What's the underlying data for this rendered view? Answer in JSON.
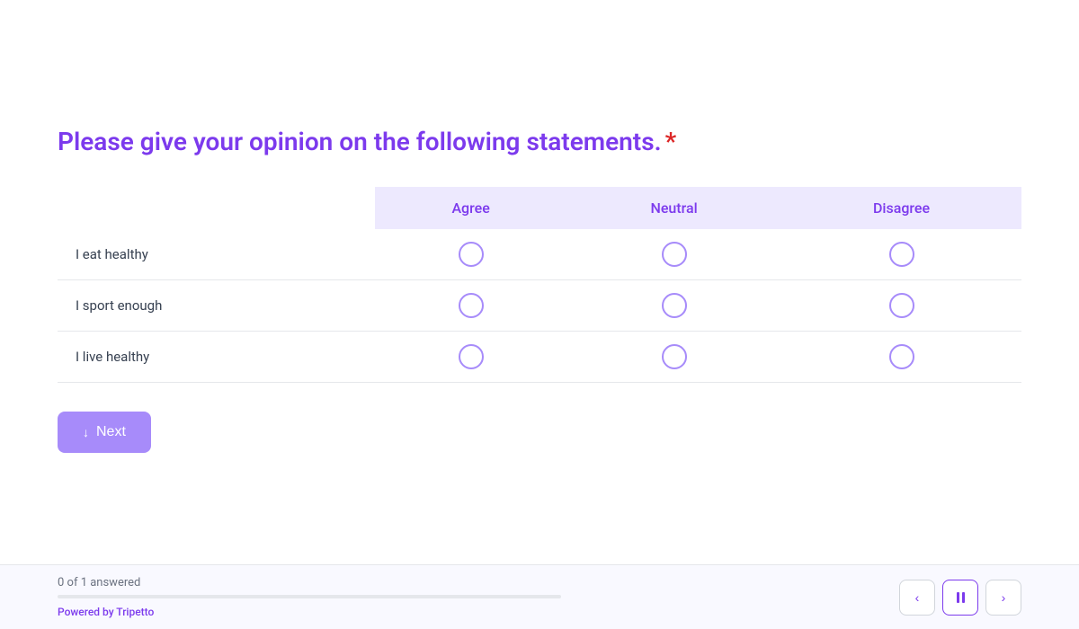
{
  "question": {
    "title": "Please give your opinion on the following statements.",
    "required": true,
    "required_symbol": "*"
  },
  "matrix": {
    "columns": [
      "Agree",
      "Neutral",
      "Disagree"
    ],
    "rows": [
      {
        "label": "I eat healthy"
      },
      {
        "label": "I sport enough"
      },
      {
        "label": "I live healthy"
      }
    ]
  },
  "next_button": {
    "label": "Next"
  },
  "footer": {
    "answered_text": "0 of 1 answered",
    "progress_percent": 0,
    "powered_by_prefix": "Powered by ",
    "powered_by_brand": "Tripetto"
  },
  "nav": {
    "prev_label": "←",
    "pause_label": "⏸",
    "next_label": "→"
  }
}
